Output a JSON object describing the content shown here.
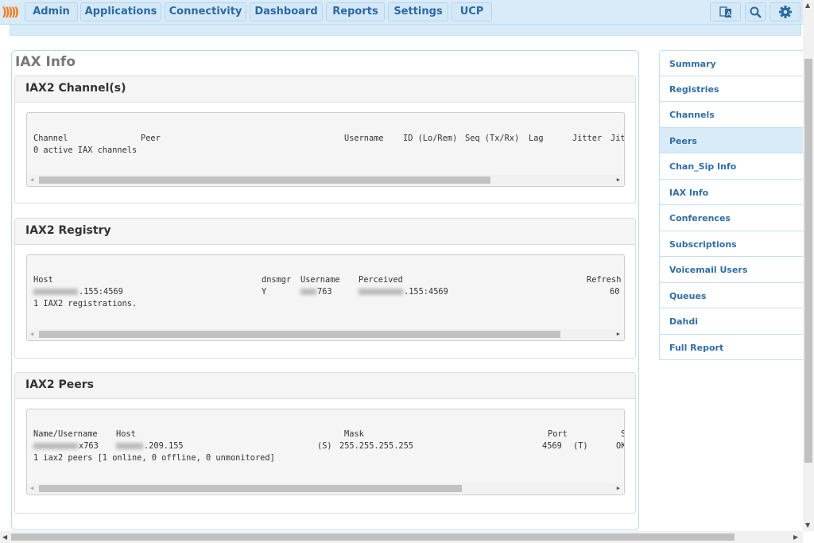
{
  "nav": {
    "items": [
      "Admin",
      "Applications",
      "Connectivity",
      "Dashboard",
      "Reports",
      "Settings",
      "UCP"
    ],
    "icons": [
      "language-icon",
      "search-icon",
      "gear-icon"
    ],
    "accent": "#2b6aa3",
    "logo_color": "#f47c20"
  },
  "page": {
    "title": "IAX Info"
  },
  "channels": {
    "title": "IAX2 Channel(s)",
    "header": [
      "Channel",
      "Peer",
      "Username",
      "ID (Lo/Rem)",
      "Seq (Tx/Rx)",
      "Lag",
      "Jitter",
      "Jit"
    ],
    "summary": "0 active IAX channels"
  },
  "registry": {
    "title": "IAX2 Registry",
    "header": [
      "Host",
      "dnsmgr",
      "Username",
      "Perceived",
      "Refresh"
    ],
    "row": {
      "host_suffix": ".155:4569",
      "dnsmgr": "Y",
      "username_suffix": "763",
      "perceived_suffix": ".155:4569",
      "refresh": "60"
    },
    "summary": "1 IAX2 registrations."
  },
  "peers": {
    "title": "IAX2 Peers",
    "header": [
      "Name/Username",
      "Host",
      "Mask",
      "Port",
      "S"
    ],
    "row": {
      "name_suffix": "x763",
      "host_suffix": ".209.155",
      "dyn": "(S)",
      "mask": "255.255.255.255",
      "port": "4569",
      "trunk": "(T)",
      "status": "OK"
    },
    "summary": "1 iax2 peers [1 online, 0 offline, 0 unmonitored]"
  },
  "sidebar": {
    "items": [
      "Summary",
      "Registries",
      "Channels",
      "Peers",
      "Chan_Sip Info",
      "IAX Info",
      "Conferences",
      "Subscriptions",
      "Voicemail Users",
      "Queues",
      "Dahdi",
      "Full Report"
    ],
    "active": "Peers"
  }
}
